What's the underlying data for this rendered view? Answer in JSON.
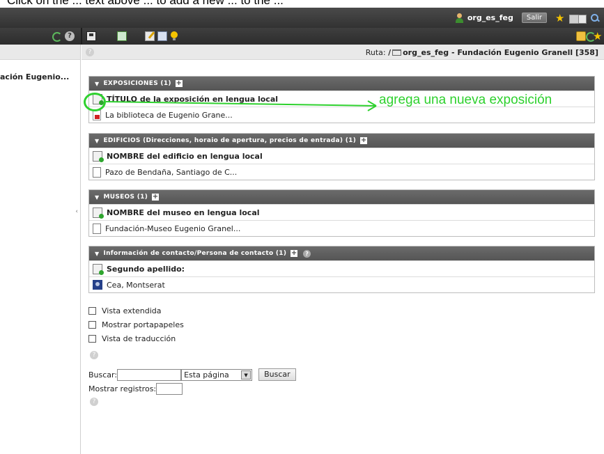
{
  "caption": "Click on the ... text above ... to add a new ... to the ...",
  "topbar": {
    "username": "org_es_feg",
    "logout_label": "Salir",
    "clipboard_count": "0"
  },
  "path": {
    "label": "Ruta:",
    "prefix": "/",
    "value": "org_es_feg - Fundación Eugenio Granell [358]"
  },
  "tree": {
    "item": "ación Eugenio..."
  },
  "sections": [
    {
      "title": "EXPOSICIONES (1)",
      "rows": [
        {
          "label": "TÍTULO de la exposición en lengua local",
          "type": "new"
        },
        {
          "label": "La biblioteca de Eugenio Grane...",
          "type": "red"
        }
      ]
    },
    {
      "title": "EDIFICIOS (Direcciones, horaio de apertura, precios de entrada) (1)",
      "rows": [
        {
          "label": "NOMBRE del edificio en lengua local",
          "type": "new"
        },
        {
          "label": "Pazo de Bendaña, Santiago de C...",
          "type": "blank"
        }
      ]
    },
    {
      "title": "MUSEOS (1)",
      "rows": [
        {
          "label": "NOMBRE del museo en lengua local",
          "type": "new"
        },
        {
          "label": "Fundación-Museo Eugenio Granel...",
          "type": "blank"
        }
      ]
    },
    {
      "title": "Información de contacto/Persona de contacto (1)",
      "rows": [
        {
          "label": "Segundo apellido:",
          "type": "new"
        },
        {
          "label": "Cea, Montserat",
          "type": "contact"
        }
      ]
    }
  ],
  "options": {
    "extended_view": "Vista extendida",
    "show_clipboard": "Mostrar portapapeles",
    "translation_view": "Vista de traducción"
  },
  "search": {
    "label": "Buscar:",
    "scope_selected": "Esta página",
    "button": "Buscar",
    "show_records_label": "Mostrar registros:"
  },
  "annotation": {
    "text": "agrega una nueva exposición",
    "color": "#2ed12e"
  },
  "colors": {
    "topbar": "#3a3a3a",
    "section_header": "#606060",
    "path_bar": "#e9e9e9"
  }
}
